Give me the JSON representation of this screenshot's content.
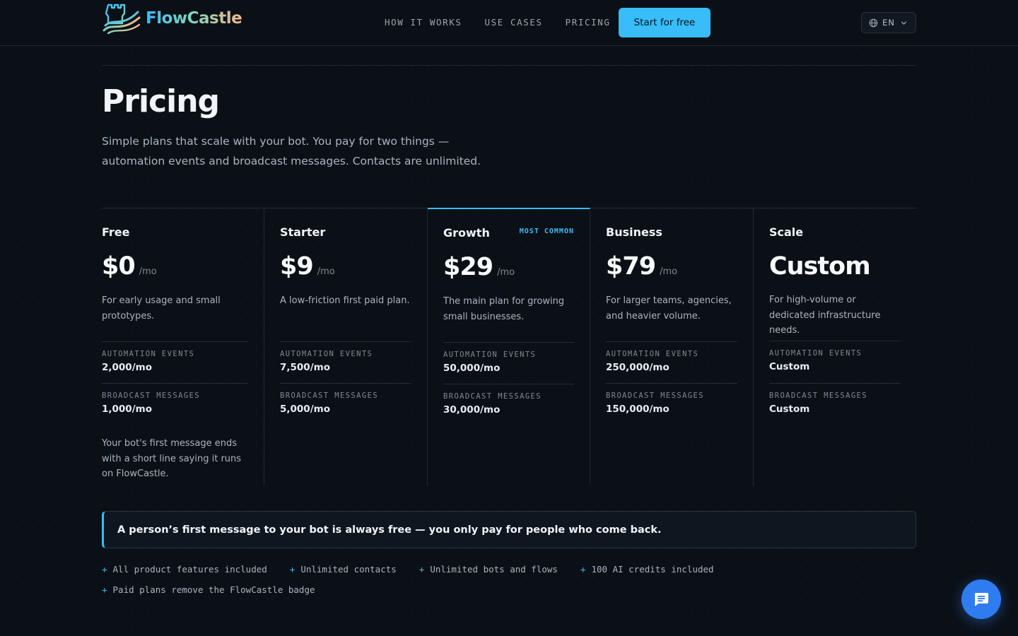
{
  "brand": {
    "name": "FlowCastle",
    "logo_icon": "castle-logo-icon"
  },
  "nav": {
    "links": [
      "HOW IT WORKS",
      "USE CASES",
      "PRICING"
    ],
    "cta_label": "Start for free",
    "language": "EN"
  },
  "page": {
    "title": "Pricing",
    "subtitle": "Simple plans that scale with your bot. You pay for two things — automation events and broadcast messages. Contacts are unlimited."
  },
  "labels": {
    "automation_events": "AUTOMATION EVENTS",
    "broadcast_messages": "BROADCAST MESSAGES",
    "per_month": "/mo"
  },
  "plans": [
    {
      "name": "Free",
      "price": "$0",
      "per": "/mo",
      "description": "For early usage and small prototypes.",
      "automation_events": "2,000/mo",
      "broadcast_messages": "1,000/mo",
      "note": "Your bot's first message ends with a short line saying it runs on FlowCastle.",
      "badge": ""
    },
    {
      "name": "Starter",
      "price": "$9",
      "per": "/mo",
      "description": "A low-friction first paid plan.",
      "automation_events": "7,500/mo",
      "broadcast_messages": "5,000/mo",
      "note": "",
      "badge": ""
    },
    {
      "name": "Growth",
      "price": "$29",
      "per": "/mo",
      "description": "The main plan for growing small businesses.",
      "automation_events": "50,000/mo",
      "broadcast_messages": "30,000/mo",
      "note": "",
      "badge": "MOST COMMON"
    },
    {
      "name": "Business",
      "price": "$79",
      "per": "/mo",
      "description": "For larger teams, agencies, and heavier volume.",
      "automation_events": "250,000/mo",
      "broadcast_messages": "150,000/mo",
      "note": "",
      "badge": ""
    },
    {
      "name": "Scale",
      "price": "Custom",
      "per": "",
      "description": "For high-volume or dedicated infrastructure needs.",
      "automation_events": "Custom",
      "broadcast_messages": "Custom",
      "note": "",
      "badge": ""
    }
  ],
  "callout": "A person’s first message to your bot is always free — you only pay for people who come back.",
  "features": [
    "All product features included",
    "Unlimited contacts",
    "Unlimited bots and flows",
    "100 AI credits included",
    "Paid plans remove the FlowCastle badge"
  ],
  "feature_marker": "+",
  "colors": {
    "accent": "#38bdf8",
    "background": "#0b1017",
    "chat_button": "#2f7cf0"
  },
  "chat_icon": "chat-bubble-icon"
}
